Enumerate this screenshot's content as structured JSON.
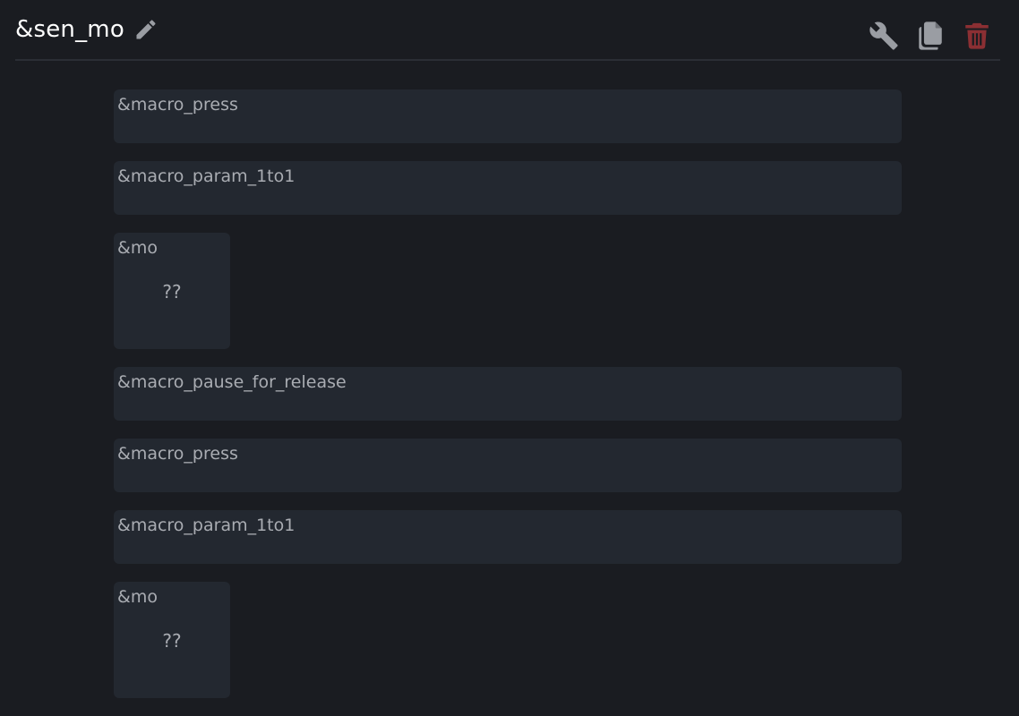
{
  "header": {
    "title": "&sen_mo",
    "icons": [
      "pencil-icon",
      "wrench-icon",
      "copy-icon",
      "trash-icon"
    ]
  },
  "colors": {
    "background": "#1a1c21",
    "card": "#232830",
    "label": "#a9acb2",
    "icon": "#9a9da3",
    "delete": "#8b2f33"
  },
  "bindings": [
    {
      "label": "&macro_press",
      "param": ""
    },
    {
      "label": "&macro_param_1to1",
      "param": ""
    },
    {
      "label": "&mo",
      "param": "??"
    },
    {
      "label": "&macro_pause_for_release",
      "param": ""
    },
    {
      "label": "&macro_press",
      "param": ""
    },
    {
      "label": "&macro_param_1to1",
      "param": ""
    },
    {
      "label": "&mo",
      "param": "??"
    }
  ]
}
